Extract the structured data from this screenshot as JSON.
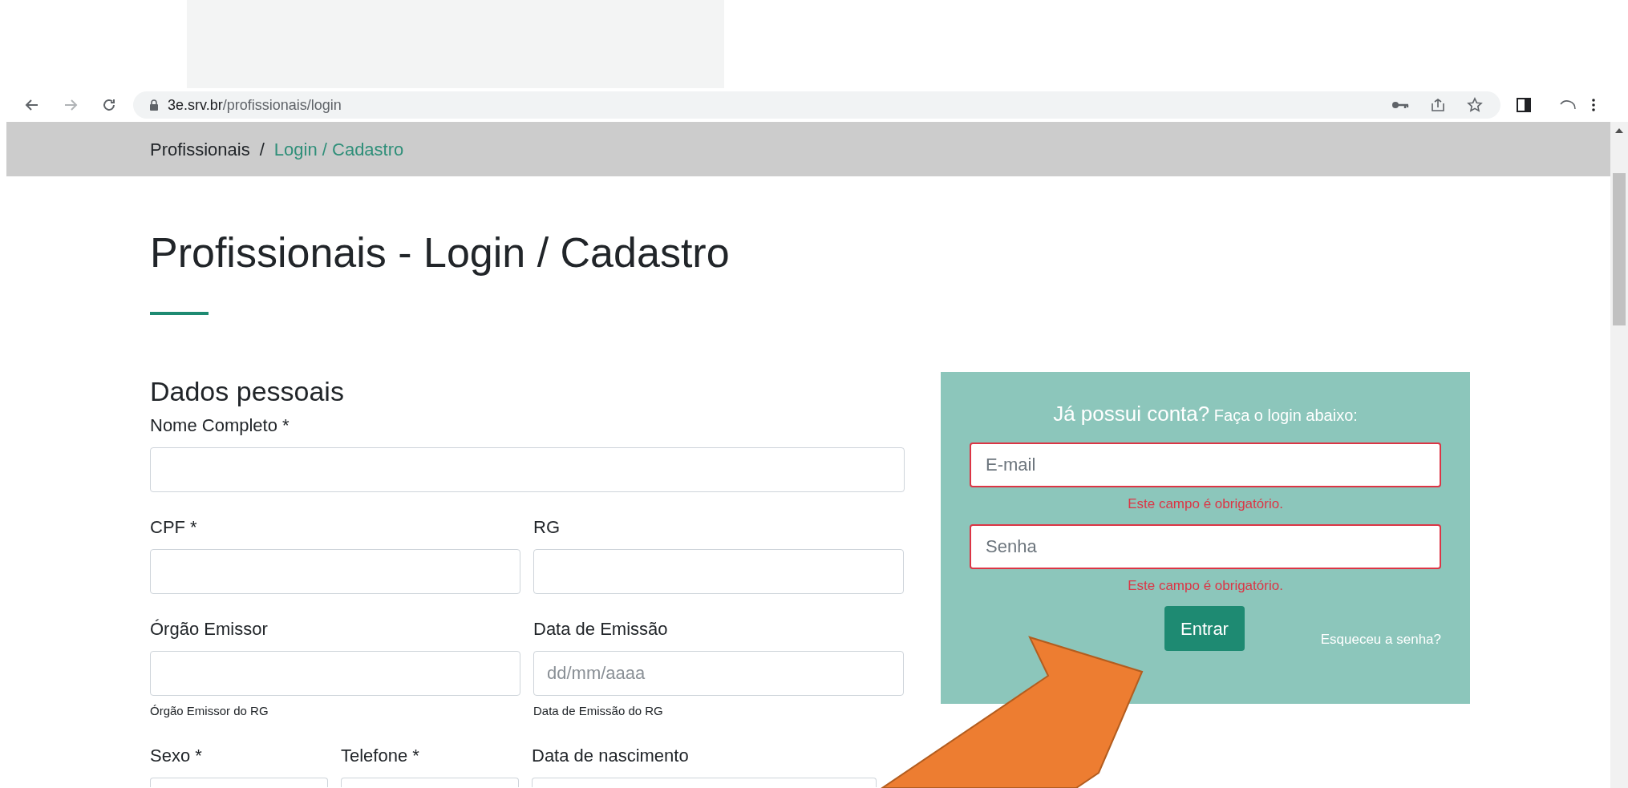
{
  "browser": {
    "url_host": "3e.srv.br",
    "url_path": "/profissionais/login"
  },
  "breadcrumb_separator": "/",
  "breadcrumb": [
    {
      "label": "Profissionais",
      "current": false
    },
    {
      "label": "Login / Cadastro",
      "current": true
    }
  ],
  "page_title": "Profissionais - Login / Cadastro",
  "form": {
    "section_title": "Dados pessoais",
    "rows": [
      [
        {
          "label": "Nome Completo *"
        }
      ],
      [
        {
          "label": "CPF *"
        },
        {
          "label": "RG"
        }
      ],
      [
        {
          "label": "Órgão Emissor",
          "help": "Órgão Emissor do RG"
        },
        {
          "label": "Data de Emissão",
          "placeholder": "dd/mm/aaaa",
          "help": "Data de Emissão do RG"
        }
      ],
      [
        {
          "label": "Sexo *"
        },
        {
          "label": "Telefone *"
        },
        {
          "label": "Data de nascimento"
        }
      ]
    ]
  },
  "login": {
    "heading": "Já possui conta?",
    "heading_sub": "Faça o login abaixo:",
    "fields": [
      {
        "placeholder": "E-mail",
        "invalid": true,
        "error": "Este campo é obrigatório."
      },
      {
        "placeholder": "Senha",
        "invalid": true,
        "error": "Este campo é obrigatório."
      }
    ],
    "submit": "Entrar",
    "forgot_link": "Esqueceu a senha?"
  }
}
